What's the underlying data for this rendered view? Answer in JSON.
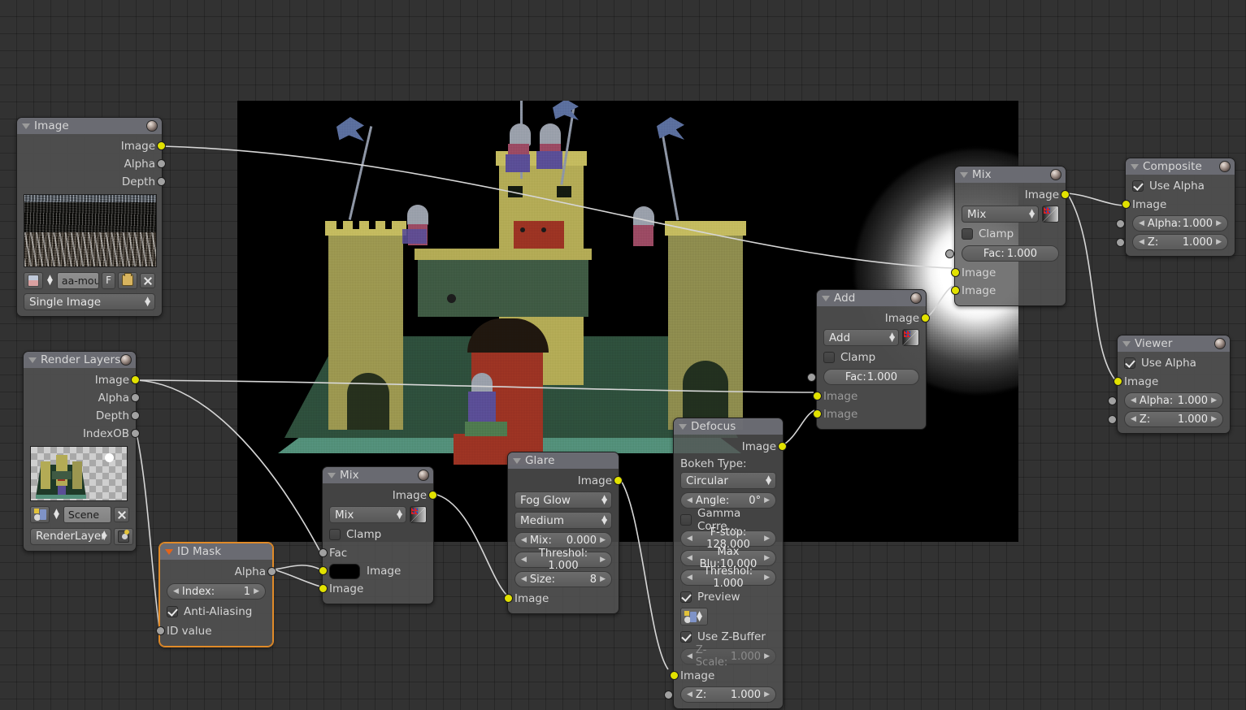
{
  "app": "Blender Node Compositor",
  "canvas": {
    "grid": true,
    "bg_color": "#323232",
    "grid_color": "#272727"
  },
  "backdrop": {
    "name": "render-backdrop",
    "description": "LEGO castle render with bright sun glow"
  },
  "nodes": {
    "image": {
      "title": "Image",
      "outputs": [
        "Image",
        "Alpha",
        "Depth"
      ],
      "file_name": "aa-mou...",
      "f_label": "F",
      "source": "Single Image"
    },
    "render_layers": {
      "title": "Render Layers",
      "outputs": [
        "Image",
        "Alpha",
        "Depth",
        "IndexOB"
      ],
      "scene": "Scene",
      "layer": "RenderLayer"
    },
    "id_mask": {
      "title": "ID Mask",
      "outputs": [
        "Alpha"
      ],
      "index_label": "Index:",
      "index_value": "1",
      "anti_aliasing_label": "Anti-Aliasing",
      "anti_aliasing_checked": true,
      "inputs": [
        "ID value"
      ],
      "selected": true
    },
    "mix_lower": {
      "title": "Mix",
      "outputs": [
        "Image"
      ],
      "blend_mode": "Mix",
      "clamp_label": "Clamp",
      "clamp_checked": false,
      "inputs": [
        "Fac",
        "Image",
        "Image"
      ],
      "color_swatch": "#000000"
    },
    "glare": {
      "title": "Glare",
      "outputs": [
        "Image"
      ],
      "glare_type": "Fog Glow",
      "quality": "Medium",
      "mix_label": "Mix:",
      "mix_value": "0.000",
      "threshold_label": "Threshol: 1.000",
      "size_label": "Size:",
      "size_value": "8",
      "inputs": [
        "Image"
      ]
    },
    "defocus": {
      "title": "Defocus",
      "outputs": [
        "Image"
      ],
      "bokeh_label": "Bokeh Type:",
      "bokeh_type": "Circular",
      "angle_label": "Angle:",
      "angle_value": "0°",
      "gamma_label": "Gamma Corre...",
      "gamma_checked": false,
      "fstop_label": "F-stop: 128.000",
      "maxblur_label": "Max Blu:10.000",
      "threshold_label": "Threshol: 1.000",
      "preview_label": "Preview",
      "preview_checked": true,
      "scene_picker": "scene-icon",
      "zbuffer_label": "Use Z-Buffer",
      "zbuffer_checked": true,
      "zscale_label": "Z-Scale:",
      "zscale_value": "1.000",
      "zscale_disabled": true,
      "inputs": [
        "Image"
      ],
      "z_label": "Z:",
      "z_value": "1.000"
    },
    "add": {
      "title": "Add",
      "outputs": [
        "Image"
      ],
      "blend_mode": "Add",
      "clamp_label": "Clamp",
      "clamp_checked": false,
      "fac_label": "Fac:",
      "fac_value": "1.000",
      "inputs": [
        "Image",
        "Image"
      ]
    },
    "mix_upper": {
      "title": "Mix",
      "outputs": [
        "Image"
      ],
      "blend_mode": "Mix",
      "clamp_label": "Clamp",
      "clamp_checked": false,
      "fac_label": "Fac:",
      "fac_value": "1.000",
      "inputs": [
        "Image",
        "Image"
      ]
    },
    "composite": {
      "title": "Composite",
      "use_alpha_label": "Use Alpha",
      "use_alpha_checked": true,
      "inputs": [
        "Image"
      ],
      "alpha_label": "Alpha:",
      "alpha_value": "1.000",
      "z_label": "Z:",
      "z_value": "1.000"
    },
    "viewer": {
      "title": "Viewer",
      "use_alpha_label": "Use Alpha",
      "use_alpha_checked": true,
      "inputs": [
        "Image"
      ],
      "alpha_label": "Alpha:",
      "alpha_value": "1.000",
      "z_label": "Z:",
      "z_value": "1.000"
    }
  },
  "colors": {
    "socket_image": "#e2e200",
    "socket_value": "#a1a1a1",
    "selected_outline": "#e08a28",
    "node_bg": "#505050",
    "header_bg": "#6e7078"
  }
}
